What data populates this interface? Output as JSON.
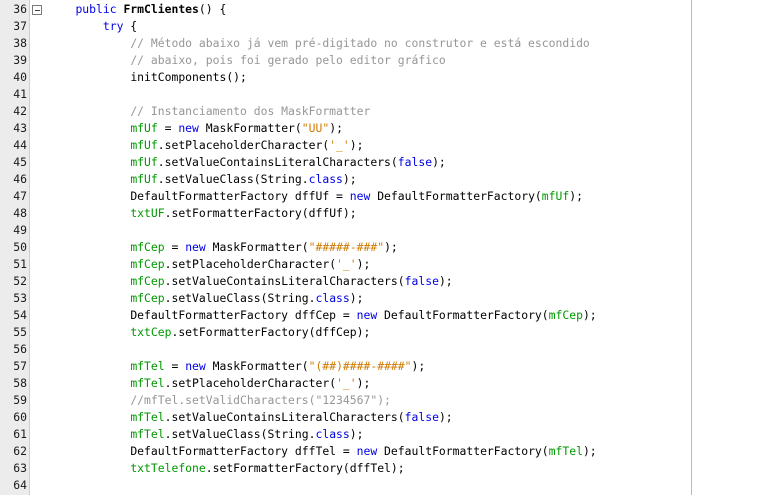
{
  "editor": {
    "colors": {
      "keyword": "#0000e6",
      "field": "#009900",
      "string": "#ce7b00",
      "comment": "#969696",
      "plain": "#000000",
      "gutter": "#ececec"
    },
    "fold_icon": "collapse-minus-icon",
    "lines": [
      {
        "num": "36",
        "indent": 4,
        "fold": true,
        "tokens": [
          {
            "t": "public ",
            "c": "kw"
          },
          {
            "t": "FrmClientes",
            "c": "decl"
          },
          {
            "t": "() {",
            "c": "plain"
          }
        ]
      },
      {
        "num": "37",
        "indent": 8,
        "tokens": [
          {
            "t": "try",
            "c": "kw"
          },
          {
            "t": " {",
            "c": "plain"
          }
        ]
      },
      {
        "num": "38",
        "indent": 12,
        "tokens": [
          {
            "t": "// Método abaixo já vem pré-digitado no construtor e está escondido",
            "c": "comment"
          }
        ]
      },
      {
        "num": "39",
        "indent": 12,
        "tokens": [
          {
            "t": "// abaixo, pois foi gerado pelo editor gráfico",
            "c": "comment"
          }
        ]
      },
      {
        "num": "40",
        "indent": 12,
        "tokens": [
          {
            "t": "initComponents();",
            "c": "plain"
          }
        ]
      },
      {
        "num": "41",
        "indent": 0,
        "tokens": []
      },
      {
        "num": "42",
        "indent": 12,
        "tokens": [
          {
            "t": "// Instanciamento dos MaskFormatter",
            "c": "comment"
          }
        ]
      },
      {
        "num": "43",
        "indent": 12,
        "tokens": [
          {
            "t": "mfUf",
            "c": "field"
          },
          {
            "t": " = ",
            "c": "plain"
          },
          {
            "t": "new",
            "c": "kw"
          },
          {
            "t": " MaskFormatter(",
            "c": "plain"
          },
          {
            "t": "\"UU\"",
            "c": "str"
          },
          {
            "t": ");",
            "c": "plain"
          }
        ]
      },
      {
        "num": "44",
        "indent": 12,
        "tokens": [
          {
            "t": "mfUf",
            "c": "field"
          },
          {
            "t": ".setPlaceholderCharacter(",
            "c": "plain"
          },
          {
            "t": "'_'",
            "c": "str"
          },
          {
            "t": ");",
            "c": "plain"
          }
        ]
      },
      {
        "num": "45",
        "indent": 12,
        "tokens": [
          {
            "t": "mfUf",
            "c": "field"
          },
          {
            "t": ".setValueContainsLiteralCharacters(",
            "c": "plain"
          },
          {
            "t": "false",
            "c": "kw"
          },
          {
            "t": ");",
            "c": "plain"
          }
        ]
      },
      {
        "num": "46",
        "indent": 12,
        "tokens": [
          {
            "t": "mfUf",
            "c": "field"
          },
          {
            "t": ".setValueClass(String.",
            "c": "plain"
          },
          {
            "t": "class",
            "c": "kw"
          },
          {
            "t": ");",
            "c": "plain"
          }
        ]
      },
      {
        "num": "47",
        "indent": 12,
        "tokens": [
          {
            "t": "DefaultFormatterFactory dffUf = ",
            "c": "plain"
          },
          {
            "t": "new",
            "c": "kw"
          },
          {
            "t": " DefaultFormatterFactory(",
            "c": "plain"
          },
          {
            "t": "mfUf",
            "c": "field"
          },
          {
            "t": ");",
            "c": "plain"
          }
        ]
      },
      {
        "num": "48",
        "indent": 12,
        "tokens": [
          {
            "t": "txtUF",
            "c": "field"
          },
          {
            "t": ".setFormatterFactory(dffUf);",
            "c": "plain"
          }
        ]
      },
      {
        "num": "49",
        "indent": 0,
        "tokens": []
      },
      {
        "num": "50",
        "indent": 12,
        "tokens": [
          {
            "t": "mfCep",
            "c": "field"
          },
          {
            "t": " = ",
            "c": "plain"
          },
          {
            "t": "new",
            "c": "kw"
          },
          {
            "t": " MaskFormatter(",
            "c": "plain"
          },
          {
            "t": "\"#####-###\"",
            "c": "str"
          },
          {
            "t": ");",
            "c": "plain"
          }
        ]
      },
      {
        "num": "51",
        "indent": 12,
        "tokens": [
          {
            "t": "mfCep",
            "c": "field"
          },
          {
            "t": ".setPlaceholderCharacter(",
            "c": "plain"
          },
          {
            "t": "'_'",
            "c": "str"
          },
          {
            "t": ");",
            "c": "plain"
          }
        ]
      },
      {
        "num": "52",
        "indent": 12,
        "tokens": [
          {
            "t": "mfCep",
            "c": "field"
          },
          {
            "t": ".setValueContainsLiteralCharacters(",
            "c": "plain"
          },
          {
            "t": "false",
            "c": "kw"
          },
          {
            "t": ");",
            "c": "plain"
          }
        ]
      },
      {
        "num": "53",
        "indent": 12,
        "tokens": [
          {
            "t": "mfCep",
            "c": "field"
          },
          {
            "t": ".setValueClass(String.",
            "c": "plain"
          },
          {
            "t": "class",
            "c": "kw"
          },
          {
            "t": ");",
            "c": "plain"
          }
        ]
      },
      {
        "num": "54",
        "indent": 12,
        "tokens": [
          {
            "t": "DefaultFormatterFactory dffCep = ",
            "c": "plain"
          },
          {
            "t": "new",
            "c": "kw"
          },
          {
            "t": " DefaultFormatterFactory(",
            "c": "plain"
          },
          {
            "t": "mfCep",
            "c": "field"
          },
          {
            "t": ");",
            "c": "plain"
          }
        ]
      },
      {
        "num": "55",
        "indent": 12,
        "tokens": [
          {
            "t": "txtCep",
            "c": "field"
          },
          {
            "t": ".setFormatterFactory(dffCep);",
            "c": "plain"
          }
        ]
      },
      {
        "num": "56",
        "indent": 0,
        "tokens": []
      },
      {
        "num": "57",
        "indent": 12,
        "tokens": [
          {
            "t": "mfTel",
            "c": "field"
          },
          {
            "t": " = ",
            "c": "plain"
          },
          {
            "t": "new",
            "c": "kw"
          },
          {
            "t": " MaskFormatter(",
            "c": "plain"
          },
          {
            "t": "\"(##)####-####\"",
            "c": "str"
          },
          {
            "t": ");",
            "c": "plain"
          }
        ]
      },
      {
        "num": "58",
        "indent": 12,
        "tokens": [
          {
            "t": "mfTel",
            "c": "field"
          },
          {
            "t": ".setPlaceholderCharacter(",
            "c": "plain"
          },
          {
            "t": "'_'",
            "c": "str"
          },
          {
            "t": ");",
            "c": "plain"
          }
        ]
      },
      {
        "num": "59",
        "indent": 12,
        "tokens": [
          {
            "t": "//mfTel.setValidCharacters(\"1234567\");",
            "c": "comment"
          }
        ]
      },
      {
        "num": "60",
        "indent": 12,
        "tokens": [
          {
            "t": "mfTel",
            "c": "field"
          },
          {
            "t": ".setValueContainsLiteralCharacters(",
            "c": "plain"
          },
          {
            "t": "false",
            "c": "kw"
          },
          {
            "t": ");",
            "c": "plain"
          }
        ]
      },
      {
        "num": "61",
        "indent": 12,
        "tokens": [
          {
            "t": "mfTel",
            "c": "field"
          },
          {
            "t": ".setValueClass(String.",
            "c": "plain"
          },
          {
            "t": "class",
            "c": "kw"
          },
          {
            "t": ");",
            "c": "plain"
          }
        ]
      },
      {
        "num": "62",
        "indent": 12,
        "tokens": [
          {
            "t": "DefaultFormatterFactory dffTel = ",
            "c": "plain"
          },
          {
            "t": "new",
            "c": "kw"
          },
          {
            "t": " DefaultFormatterFactory(",
            "c": "plain"
          },
          {
            "t": "mfTel",
            "c": "field"
          },
          {
            "t": ");",
            "c": "plain"
          }
        ]
      },
      {
        "num": "63",
        "indent": 12,
        "tokens": [
          {
            "t": "txtTelefone",
            "c": "field"
          },
          {
            "t": ".setFormatterFactory(dffTel);",
            "c": "plain"
          }
        ]
      },
      {
        "num": "64",
        "indent": 0,
        "tokens": []
      }
    ]
  }
}
